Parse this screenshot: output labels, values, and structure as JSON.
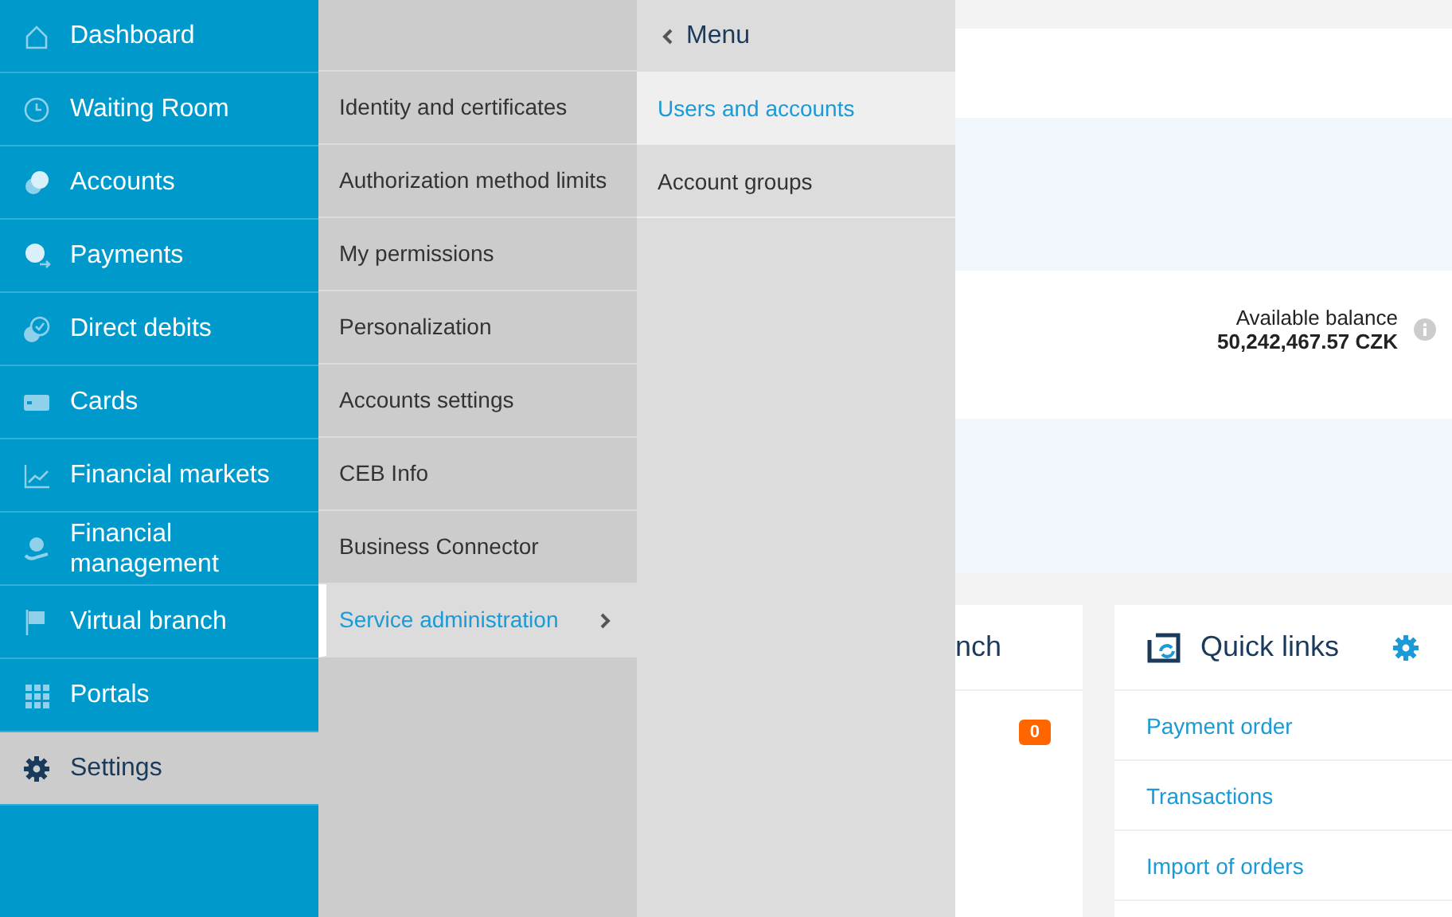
{
  "main_menu": [
    {
      "label": "Dashboard",
      "selected": false
    },
    {
      "label": "Waiting Room",
      "selected": false
    },
    {
      "label": "Accounts",
      "selected": false
    },
    {
      "label": "Payments",
      "selected": false
    },
    {
      "label": "Direct debits",
      "selected": false
    },
    {
      "label": "Cards",
      "selected": false
    },
    {
      "label": "Financial markets",
      "selected": false
    },
    {
      "label": "Financial management",
      "selected": false
    },
    {
      "label": "Virtual branch",
      "selected": false
    },
    {
      "label": "Portals",
      "selected": false
    },
    {
      "label": "Settings",
      "selected": true
    }
  ],
  "settings_menu": [
    {
      "label": "Identity and certificates",
      "selected": false
    },
    {
      "label": "Authorization method limits",
      "selected": false
    },
    {
      "label": "My permissions",
      "selected": false
    },
    {
      "label": "Personalization",
      "selected": false
    },
    {
      "label": "Accounts settings",
      "selected": false
    },
    {
      "label": "CEB Info",
      "selected": false
    },
    {
      "label": "Business Connector",
      "selected": false
    },
    {
      "label": "Service administration",
      "selected": true
    }
  ],
  "service_menu": {
    "back_label": "Menu",
    "items": [
      {
        "label": "Users and accounts",
        "selected": true
      },
      {
        "label": "Account groups",
        "selected": false
      }
    ]
  },
  "balance": {
    "label": "Available balance",
    "amount": "50,242,467.57 CZK"
  },
  "branch_card": {
    "title": "nch",
    "badge": "0"
  },
  "quick_links": {
    "title": "Quick links",
    "links": [
      "Payment order",
      "Transactions",
      "Import of orders"
    ]
  }
}
